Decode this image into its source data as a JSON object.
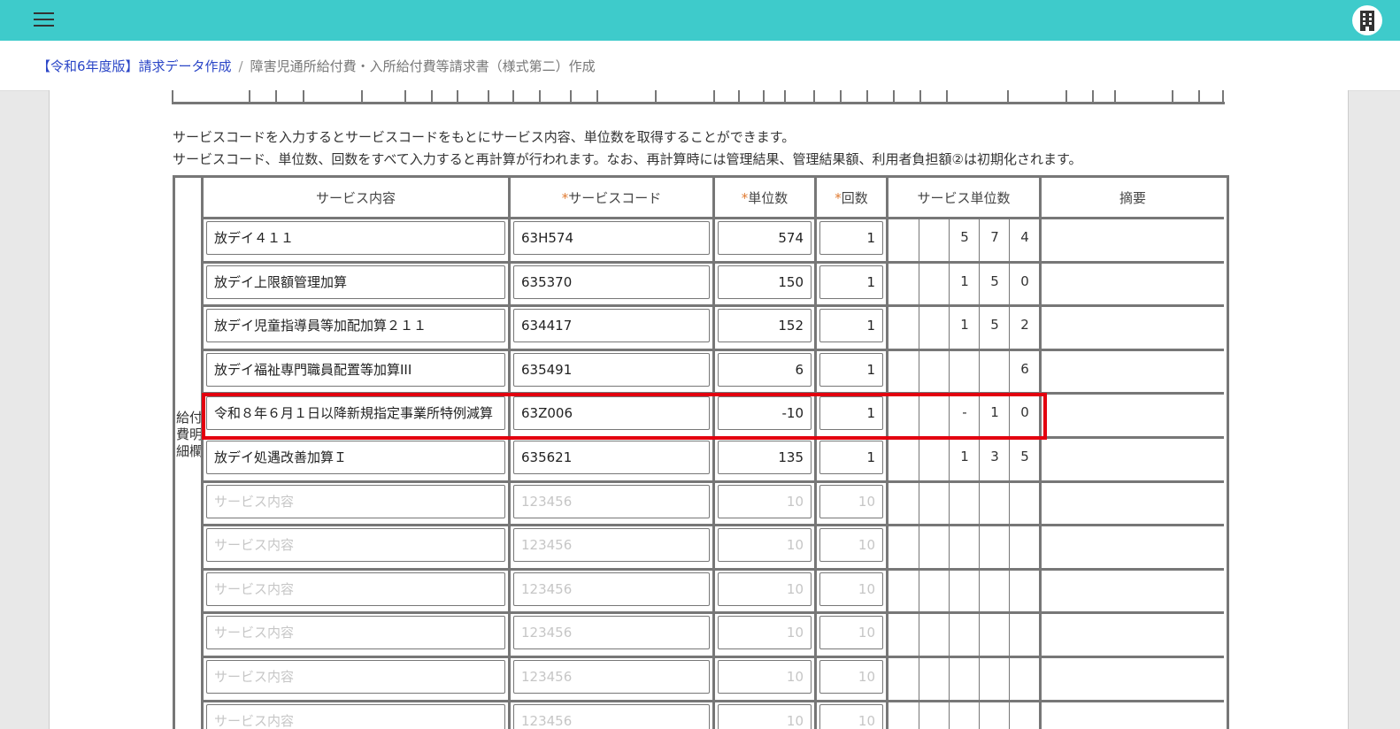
{
  "breadcrumb": {
    "link": "【令和6年度版】請求データ作成",
    "separator": "/",
    "current": "障害児通所給付費・入所給付費等請求書（様式第二）作成"
  },
  "notes": [
    "サービスコードを入力するとサービスコードをもとにサービス内容、単位数を取得することができます。",
    "サービスコード、単位数、回数をすべて入力すると再計算が行われます。なお、再計算時には管理結果、管理結果額、利用者負担額②は初期化されます。"
  ],
  "table": {
    "side_label": "給付費明細欄",
    "required_mark": "*",
    "headers": {
      "service": "サービス内容",
      "code": "サービスコード",
      "units": "単位数",
      "count": "回数",
      "service_units": "サービス単位数",
      "remarks": "摘要"
    },
    "rows": [
      {
        "service": "放デイ４１１",
        "code": "63H574",
        "units": "574",
        "count": "1",
        "digits": [
          "",
          "",
          "5",
          "7",
          "4"
        ]
      },
      {
        "service": "放デイ上限額管理加算",
        "code": "635370",
        "units": "150",
        "count": "1",
        "digits": [
          "",
          "",
          "1",
          "5",
          "0"
        ]
      },
      {
        "service": "放デイ児童指導員等加配加算２１１",
        "code": "634417",
        "units": "152",
        "count": "1",
        "digits": [
          "",
          "",
          "1",
          "5",
          "2"
        ]
      },
      {
        "service": "放デイ福祉専門職員配置等加算III",
        "code": "635491",
        "units": "6",
        "count": "1",
        "digits": [
          "",
          "",
          "",
          "",
          "6"
        ]
      },
      {
        "service": "令和８年６月１日以降新規指定事業所特例減算",
        "code": "63Z006",
        "units": "-10",
        "count": "1",
        "digits": [
          "",
          "",
          "-",
          "1",
          "0"
        ]
      },
      {
        "service": "放デイ処遇改善加算Ｉ",
        "code": "635621",
        "units": "135",
        "count": "1",
        "digits": [
          "",
          "",
          "1",
          "3",
          "5"
        ]
      }
    ],
    "placeholders": {
      "service": "サービス内容",
      "code": "123456",
      "units": "10",
      "count": "10"
    },
    "empty_rows": 6
  },
  "colors": {
    "topbar": "#3ecbcb",
    "link": "#2b46c7",
    "highlight": "#e3000f",
    "required": "#e07a30"
  },
  "icons": {
    "menu": "hamburger-icon",
    "user": "building-icon"
  }
}
